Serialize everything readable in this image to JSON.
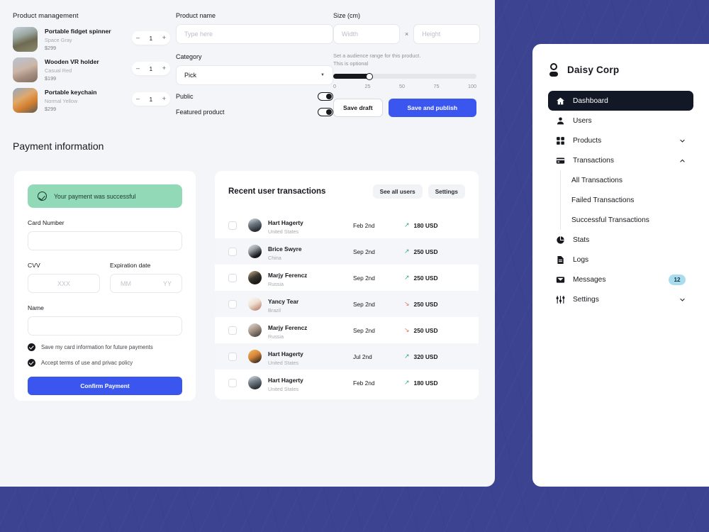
{
  "products_panel": {
    "heading": "Product management",
    "items": [
      {
        "name": "Portable fidget spinner",
        "variant": "Space Gray",
        "price": "$299",
        "qty": "1",
        "minus": "–",
        "plus": "+"
      },
      {
        "name": "Wooden VR holder",
        "variant": "Casual Red",
        "price": "$199",
        "qty": "1",
        "minus": "–",
        "plus": "+"
      },
      {
        "name": "Portable keychain",
        "variant": "Normal Yellow",
        "price": "$299",
        "qty": "1",
        "minus": "–",
        "plus": "+"
      }
    ]
  },
  "product_form": {
    "name_label": "Product name",
    "name_placeholder": "Type here",
    "name_value": "",
    "category_label": "Category",
    "category_value": "Pick",
    "public_label": "Public",
    "featured_label": "Featured product"
  },
  "size_form": {
    "size_label": "Size (cm)",
    "width_placeholder": "Width",
    "width_value": "",
    "height_placeholder": "Height",
    "height_value": "",
    "separator": "×",
    "hint_line1": "Set a audience range for this product.",
    "hint_line2": "This is optional",
    "slider_value": 25,
    "slider_ticks": [
      "0",
      "25",
      "50",
      "75",
      "100"
    ],
    "save_draft_label": "Save draft",
    "save_publish_label": "Save and publish"
  },
  "payment": {
    "section_title": "Payment information",
    "success_message": "Your payment was successful",
    "card_number_label": "Card Number",
    "card_number_value": "",
    "cvv_label": "CVV",
    "cvv_placeholder": "XXX",
    "cvv_value": "",
    "expiration_label": "Expiration date",
    "exp_month_placeholder": "MM",
    "exp_month_value": "",
    "exp_year_placeholder": "YY",
    "exp_year_value": "",
    "name_label": "Name",
    "name_value": "",
    "checkbox_save": "Save my card information for future payments",
    "checkbox_terms": "Accept terms of use and privac policy",
    "confirm_label": "Confirm Payment"
  },
  "transactions": {
    "title": "Recent user transactions",
    "see_all_label": "See all users",
    "settings_label": "Settings",
    "rows": [
      {
        "name": "Hart Hagerty",
        "country": "United States",
        "date": "Feb 2nd",
        "amount": "180 USD",
        "direction": "up"
      },
      {
        "name": "Brice Swyre",
        "country": "China",
        "date": "Sep 2nd",
        "amount": "250 USD",
        "direction": "up"
      },
      {
        "name": "Marjy Ferencz",
        "country": "Russia",
        "date": "Sep 2nd",
        "amount": "250 USD",
        "direction": "up"
      },
      {
        "name": "Yancy Tear",
        "country": "Brazil",
        "date": "Sep 2nd",
        "amount": "250 USD",
        "direction": "down"
      },
      {
        "name": "Marjy Ferencz",
        "country": "Russia",
        "date": "Sep 2nd",
        "amount": "250 USD",
        "direction": "down"
      },
      {
        "name": "Hart Hagerty",
        "country": "United States",
        "date": "Jul 2nd",
        "amount": "320 USD",
        "direction": "up"
      },
      {
        "name": "Hart Hagerty",
        "country": "United States",
        "date": "Feb 2nd",
        "amount": "180 USD",
        "direction": "up"
      }
    ]
  },
  "sidebar": {
    "brand": "Daisy Corp",
    "items": [
      {
        "label": "Dashboard",
        "icon": "home-icon",
        "active": true
      },
      {
        "label": "Users",
        "icon": "user-icon",
        "active": false
      },
      {
        "label": "Products",
        "icon": "grid-icon",
        "active": false,
        "chevron": "down"
      },
      {
        "label": "Transactions",
        "icon": "card-icon",
        "active": false,
        "chevron": "up"
      },
      {
        "label": "Stats",
        "icon": "pie-icon",
        "active": false
      },
      {
        "label": "Logs",
        "icon": "document-icon",
        "active": false
      },
      {
        "label": "Messages",
        "icon": "inbox-icon",
        "active": false,
        "badge": "12"
      },
      {
        "label": "Settings",
        "icon": "sliders-icon",
        "active": false,
        "chevron": "down"
      }
    ],
    "sub_items": [
      "All Transactions",
      "Failed Transactions",
      "Successful Transactions"
    ]
  },
  "colors": {
    "page_background": "#3c4391",
    "panel_background": "#f4f5f8",
    "accent_blue": "#3b56ef",
    "active_nav": "#121826",
    "success_green": "#92dab7",
    "badge_blue": "#a8dcee",
    "amount_up": "#2aab82",
    "amount_down": "#e8705a"
  }
}
